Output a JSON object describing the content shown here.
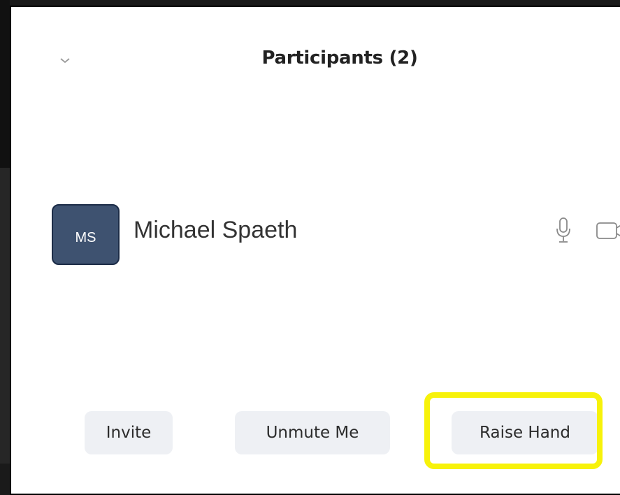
{
  "panel": {
    "title": "Participants (2)",
    "collapse_icon": "chevron-down-icon"
  },
  "participants": [
    {
      "initials": "MS",
      "name": "Michael Spaeth",
      "avatar_color": "#3e5270",
      "icons": [
        "microphone-icon",
        "video-camera-icon"
      ]
    }
  ],
  "footer": {
    "invite_label": "Invite",
    "unmute_label": "Unmute Me",
    "raise_hand_label": "Raise Hand"
  },
  "colors": {
    "highlight": "#f7f20a",
    "button_bg": "#eef0f4",
    "panel_bg": "#ffffff"
  }
}
